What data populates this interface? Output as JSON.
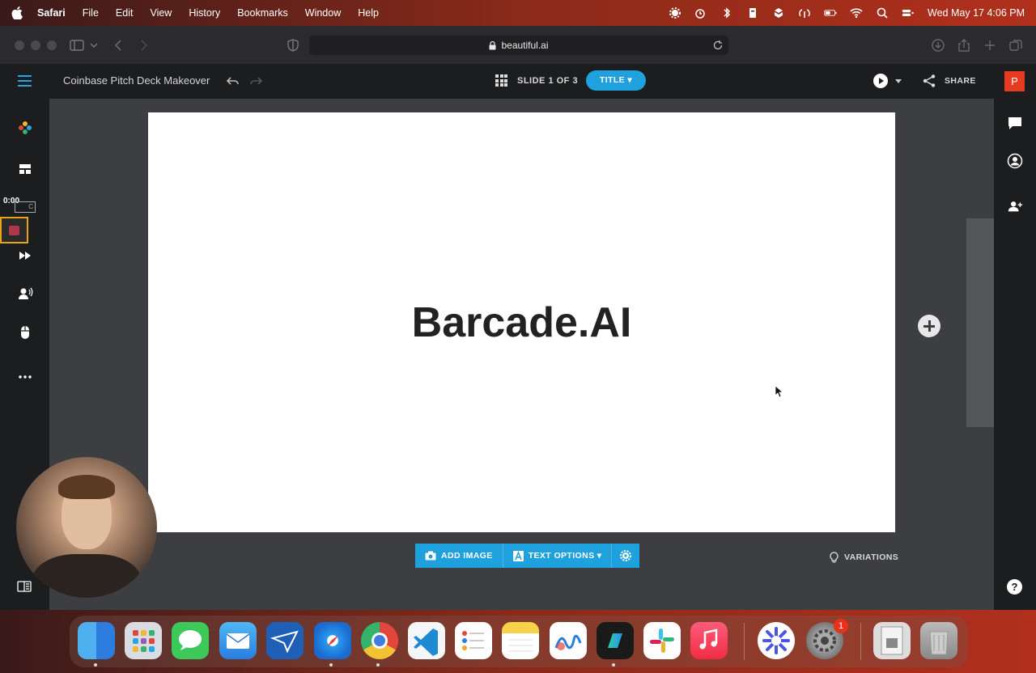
{
  "menubar": {
    "app": "Safari",
    "items": [
      "File",
      "Edit",
      "View",
      "History",
      "Bookmarks",
      "Window",
      "Help"
    ],
    "datetime": "Wed May 17  4:06 PM"
  },
  "browser": {
    "url": "beautiful.ai"
  },
  "app_header": {
    "deck_title": "Coinbase Pitch Deck Makeover",
    "slide_counter": "SLIDE 1 OF 3",
    "layout_button": "TITLE ▾",
    "share_label": "SHARE",
    "avatar_letter": "P"
  },
  "left_panel": {
    "recording_time": "0:00",
    "recording_tag": "C"
  },
  "slide": {
    "title": "Barcade.AI"
  },
  "slide_toolbar": {
    "add_image": "ADD IMAGE",
    "text_options": "TEXT OPTIONS ▾"
  },
  "variations_label": "VARIATIONS",
  "help_label": "?",
  "dock": {
    "badge_count": "1"
  },
  "colors": {
    "accent": "#1ea1dc",
    "slide_bg": "#ffffff",
    "canvas_bg": "#3d3e41",
    "avatar": "#e63b20"
  }
}
